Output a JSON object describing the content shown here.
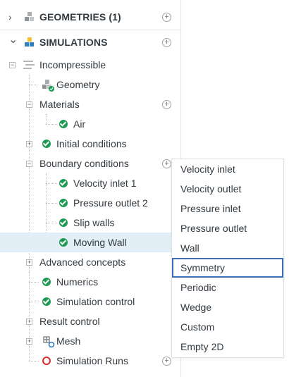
{
  "tree": {
    "geometries_label": "GEOMETRIES (1)",
    "simulations_label": "SIMULATIONS",
    "incompressible_label": "Incompressible",
    "geometry_label": "Geometry",
    "materials_label": "Materials",
    "air_label": "Air",
    "initial_conditions_label": "Initial conditions",
    "boundary_conditions_label": "Boundary conditions",
    "velocity_inlet_label": "Velocity inlet 1",
    "pressure_outlet_label": "Pressure outlet 2",
    "slip_walls_label": "Slip walls",
    "moving_wall_label": "Moving Wall",
    "advanced_concepts_label": "Advanced concepts",
    "numerics_label": "Numerics",
    "simulation_control_label": "Simulation control",
    "result_control_label": "Result control",
    "mesh_label": "Mesh",
    "simulation_runs_label": "Simulation Runs",
    "plus_symbol": "+",
    "expand_symbol": "+",
    "collapse_symbol": "−",
    "chevron_right": "›",
    "chevron_down": "⌄"
  },
  "menu": {
    "items": [
      "Velocity inlet",
      "Velocity outlet",
      "Pressure inlet",
      "Pressure outlet",
      "Wall",
      "Symmetry",
      "Periodic",
      "Wedge",
      "Custom",
      "Empty 2D"
    ],
    "active_item": "Symmetry"
  },
  "icons": {
    "check": "check-circle-icon",
    "error": "error-ring-icon",
    "geometry": "geometry-cubes-icon",
    "simulations": "simulations-cubes-icon",
    "incompressible": "incompressible-lines-icon",
    "mesh": "mesh-icon",
    "add": "plus-circle-icon"
  },
  "colors": {
    "success": "#1e9a52",
    "error": "#e02b2b",
    "selected_row": "#e3eff6",
    "menu_focus": "#3d6fb8",
    "sim_blue": "#2f7fc1",
    "sim_yellow": "#f2c230"
  }
}
